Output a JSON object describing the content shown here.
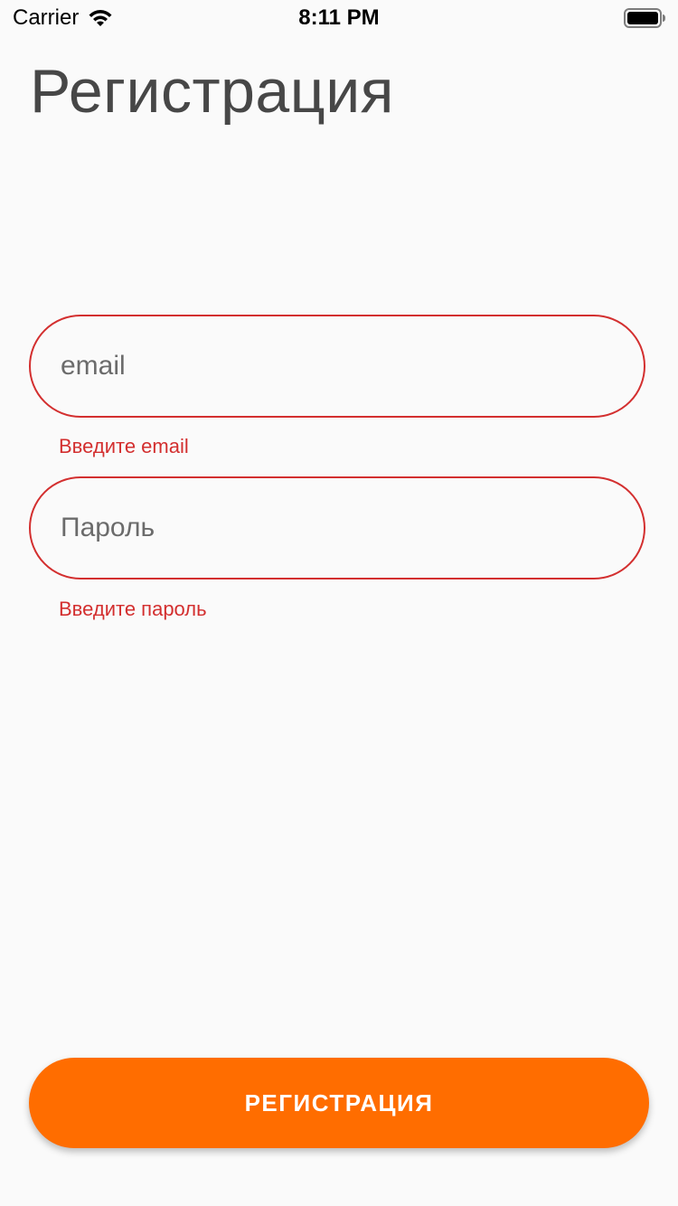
{
  "status_bar": {
    "carrier": "Carrier",
    "time": "8:11 PM",
    "wifi_icon": "wifi-icon",
    "battery_icon": "battery-icon"
  },
  "page": {
    "title": "Регистрация"
  },
  "form": {
    "email": {
      "placeholder": "email",
      "value": "",
      "error": "Введите email"
    },
    "password": {
      "placeholder": "Пароль",
      "value": "",
      "error": "Введите пароль"
    },
    "submit_label": "РЕГИСТРАЦИЯ"
  },
  "colors": {
    "background": "#fafafa",
    "error": "#d32f2f",
    "accent": "#ff6d00",
    "title": "#474747"
  }
}
